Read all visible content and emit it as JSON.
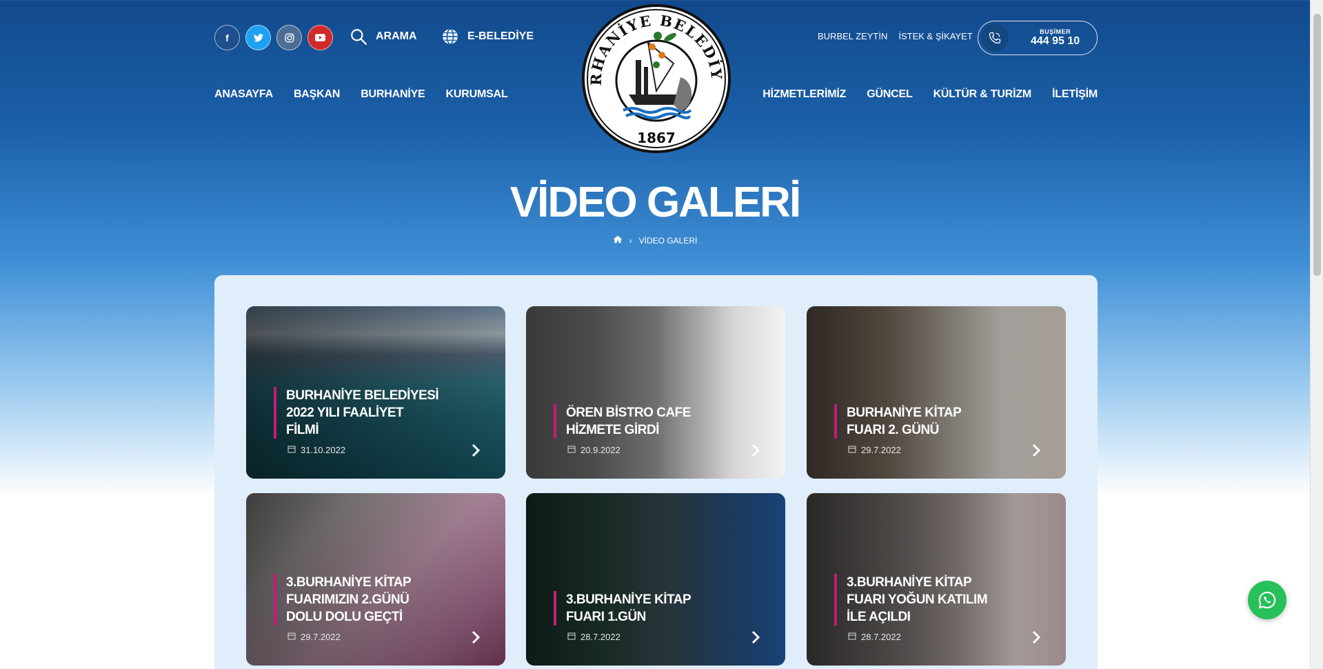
{
  "header": {
    "social": [
      "facebook",
      "twitter",
      "instagram",
      "youtube"
    ],
    "search_label": "ARAMA",
    "ebelediye_label": "E-BELEDİYE",
    "links": [
      "BURBEL ZEYTİN",
      "İSTEK & ŞİKAYET"
    ],
    "phone": {
      "label": "BUŞİMER",
      "number": "444 95 10"
    }
  },
  "logo": {
    "text": "BURHANİYE BELEDİYESİ",
    "year": "1867"
  },
  "nav": {
    "left": [
      "ANASAYFA",
      "BAŞKAN",
      "BURHANİYE",
      "KURUMSAL"
    ],
    "right": [
      "HİZMETLERİMİZ",
      "GÜNCEL",
      "KÜLTÜR & TURİZM",
      "İLETİŞİM"
    ]
  },
  "page": {
    "title": "VİDEO GALERİ",
    "breadcrumb": [
      "home-icon",
      "VİDEO GALERİ"
    ]
  },
  "videos": [
    {
      "title": "BURHANİYE BELEDİYESİ 2022 YILI FAALİYET FİLMİ",
      "date": "31.10.2022"
    },
    {
      "title": "ÖREN BİSTRO CAFE HİZMETE GİRDİ",
      "date": "20.9.2022"
    },
    {
      "title": "BURHANİYE KİTAP FUARI 2. GÜNÜ",
      "date": "29.7.2022"
    },
    {
      "title": "3.BURHANİYE KİTAP FUARIMIZIN 2.GÜNÜ DOLU DOLU GEÇTİ",
      "date": "29.7.2022"
    },
    {
      "title": "3.BURHANİYE KİTAP FUARI 1.GÜN",
      "date": "28.7.2022"
    },
    {
      "title": "3.BURHANİYE KİTAP FUARI YOĞUN KATILIM İLE AÇILDI",
      "date": "28.7.2022"
    }
  ],
  "colors": {
    "accent": "#c41b7a",
    "whatsapp": "#28c05a",
    "header_blue": "#124a8c"
  }
}
